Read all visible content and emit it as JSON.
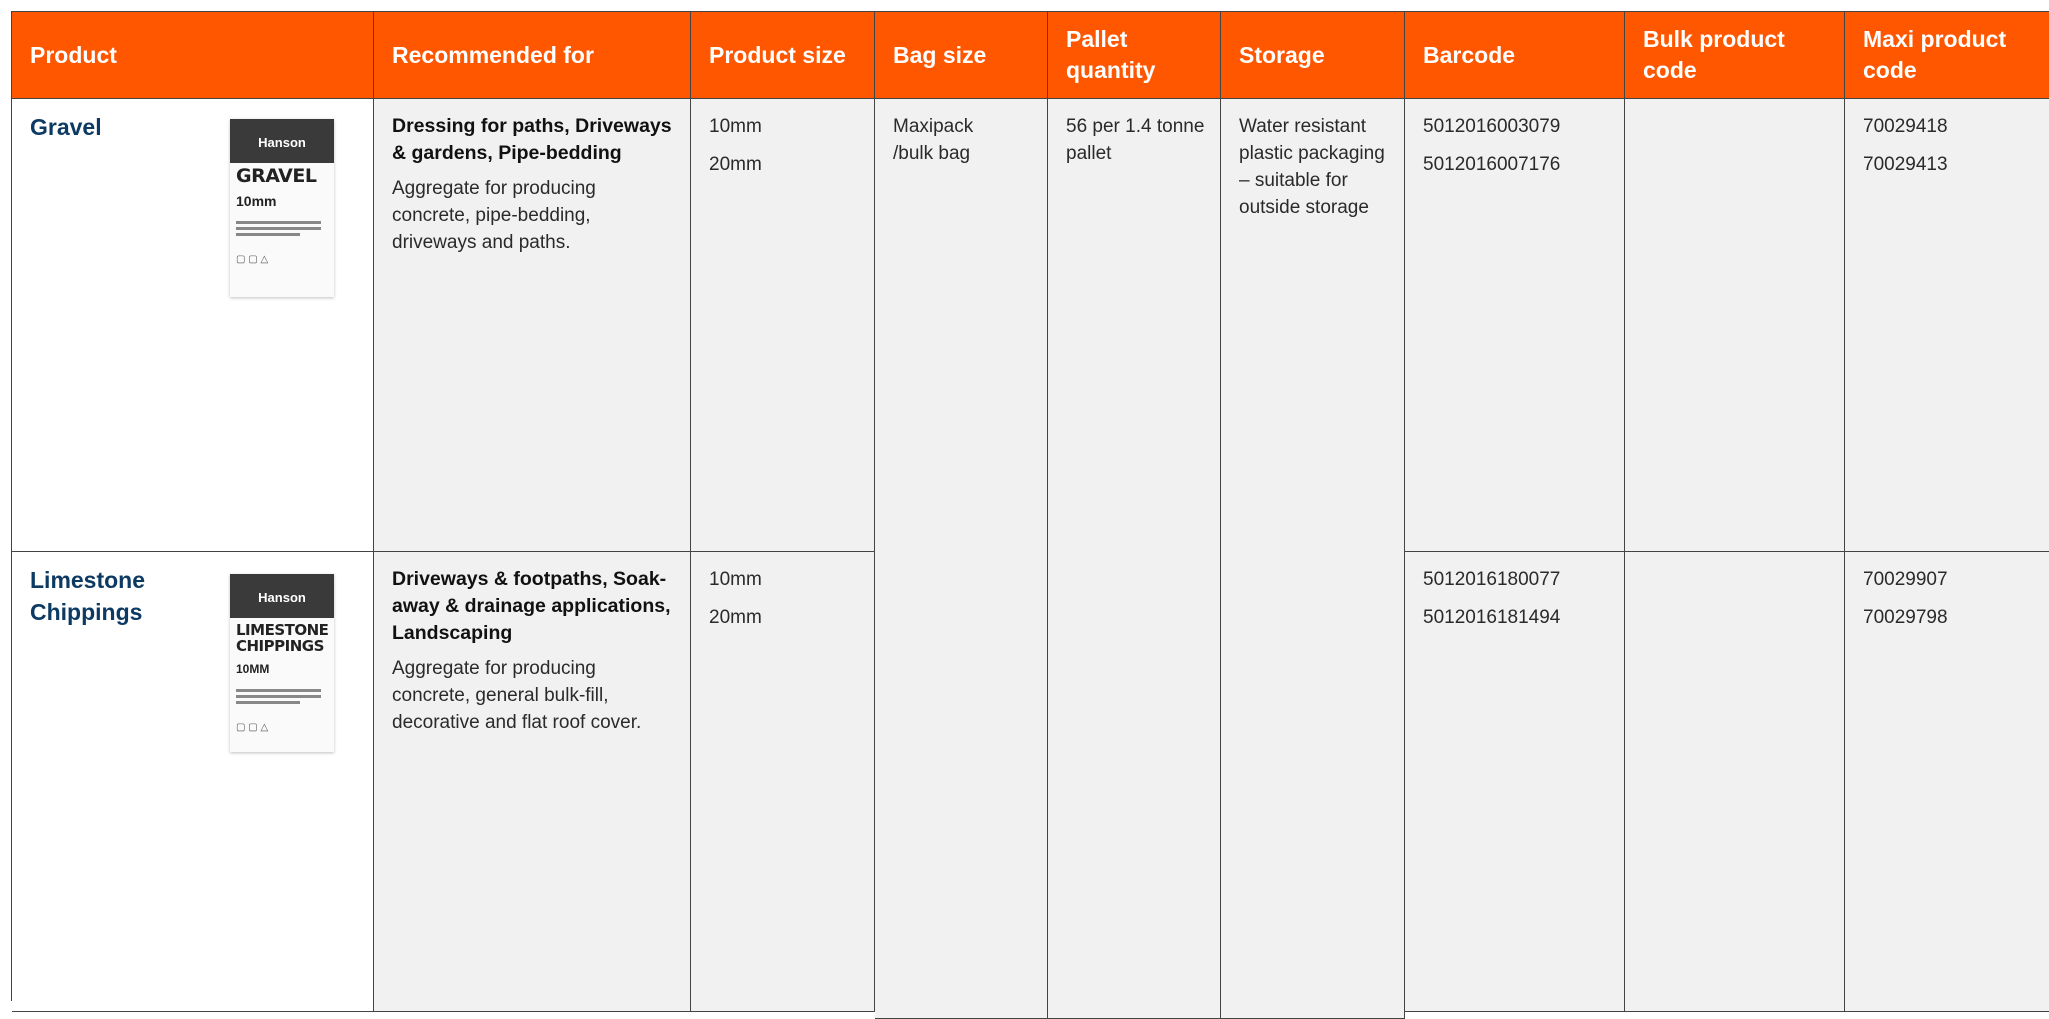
{
  "headers": {
    "product": "Product",
    "recommended": "Recommended for",
    "size": "Product size",
    "bag": "Bag size",
    "pallet": "Pallet quantity",
    "storage": "Storage",
    "barcode": "Barcode",
    "bulk": "Bulk product code",
    "maxi": "Maxi product code"
  },
  "rows": [
    {
      "name": "Gravel",
      "bag_brand": "Hanson",
      "bag_name": "GRAVEL",
      "bag_sub": "10mm",
      "rec_title": "Dressing for paths, Driveways & gardens, Pipe-bedding",
      "rec_desc": "Aggregate for producing concrete, pipe-bedding, driveways and paths.",
      "sizes": [
        "10mm",
        "20mm"
      ],
      "barcodes": [
        "5012016003079",
        "5012016007176"
      ],
      "bulk_codes": [],
      "maxi_codes": [
        "70029418",
        "70029413"
      ]
    },
    {
      "name": "Limestone Chippings",
      "bag_brand": "Hanson",
      "bag_name": "LIMESTONE CHIPPINGS",
      "bag_sub": "10MM",
      "rec_title": "Driveways & footpaths, Soak-away & drainage applications, Landscaping",
      "rec_desc": "Aggregate for producing concrete, general bulk-fill, decorative and flat roof cover.",
      "sizes": [
        "10mm",
        "20mm"
      ],
      "barcodes": [
        "5012016180077",
        "5012016181494"
      ],
      "bulk_codes": [],
      "maxi_codes": [
        "70029907",
        "70029798"
      ]
    }
  ],
  "shared": {
    "bag_size": "Maxipack /bulk bag",
    "pallet_quantity": "56 per 1.4 tonne pallet",
    "storage": "Water resistant plastic packaging – suitable for outside storage"
  },
  "colors": {
    "header_bg": "#ff5600",
    "product_name": "#0d3a63",
    "cell_bg": "#f1f1f1"
  }
}
